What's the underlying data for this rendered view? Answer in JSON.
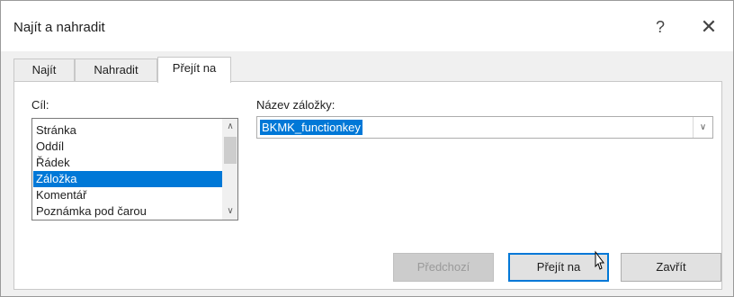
{
  "window": {
    "title": "Najít a nahradit",
    "help_label": "?",
    "close_label": "✕"
  },
  "tabs": [
    {
      "label": "Najít",
      "active": false
    },
    {
      "label": "Nahradit",
      "active": false
    },
    {
      "label": "Přejít na",
      "active": true
    }
  ],
  "target": {
    "label": "Cíl:",
    "items": [
      "Stránka",
      "Oddíl",
      "Řádek",
      "Záložka",
      "Komentář",
      "Poznámka pod čarou"
    ],
    "selected": "Záložka"
  },
  "bookmark": {
    "label": "Název záložky:",
    "value": "BKMK_functionkey"
  },
  "buttons": {
    "previous": "Předchozí",
    "goto": "Přejít na",
    "close": "Zavřít"
  },
  "colors": {
    "selection": "#0078d7",
    "dialog_bg": "#f0f0f0"
  }
}
